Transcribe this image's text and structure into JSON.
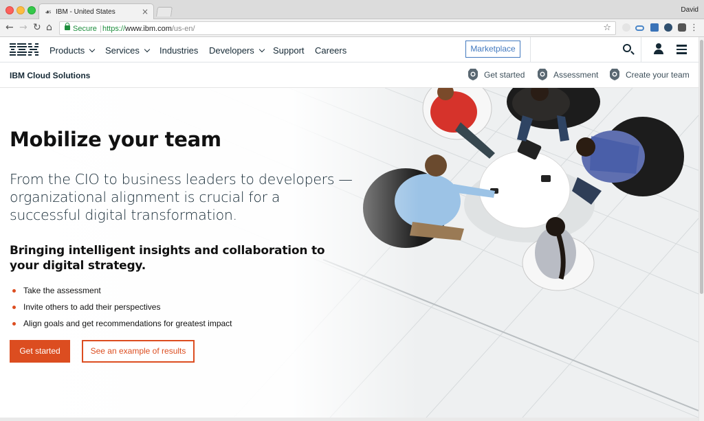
{
  "browser": {
    "tab_title": "IBM - United States",
    "profile_name": "David",
    "secure_label": "Secure",
    "url_scheme": "https://",
    "url_host": "www.ibm.com",
    "url_path": "/us-en/"
  },
  "masthead": {
    "logo": "IBM",
    "nav": [
      {
        "label": "Products",
        "dropdown": true
      },
      {
        "label": "Services",
        "dropdown": true
      },
      {
        "label": "Industries",
        "dropdown": false
      },
      {
        "label": "Developers",
        "dropdown": true
      },
      {
        "label": "Support",
        "dropdown": false
      },
      {
        "label": "Careers",
        "dropdown": false
      }
    ],
    "marketplace_label": "Marketplace"
  },
  "subnav": {
    "title": "IBM Cloud Solutions",
    "links": [
      {
        "label": "Get started",
        "icon": "badge-icon"
      },
      {
        "label": "Assessment",
        "icon": "badge-icon"
      },
      {
        "label": "Create your team",
        "icon": "badge-icon"
      }
    ]
  },
  "hero": {
    "title": "Mobilize your team",
    "lede": "From the CIO to business leaders to developers — organizational alignment is crucial for a successful digital transformation.",
    "subtitle": "Bringing intelligent insights and collaboration to your digital strategy.",
    "bullets": [
      "Take the assessment",
      "Invite others to add their perspectives",
      "Align goals and get recommendations for greatest impact"
    ],
    "primary_cta": "Get started",
    "secondary_cta": "See an example of results"
  },
  "colors": {
    "accent": "#dc4d20",
    "link_blue": "#4178be",
    "text_dark": "#152935",
    "secure_green": "#1e8e3e"
  }
}
